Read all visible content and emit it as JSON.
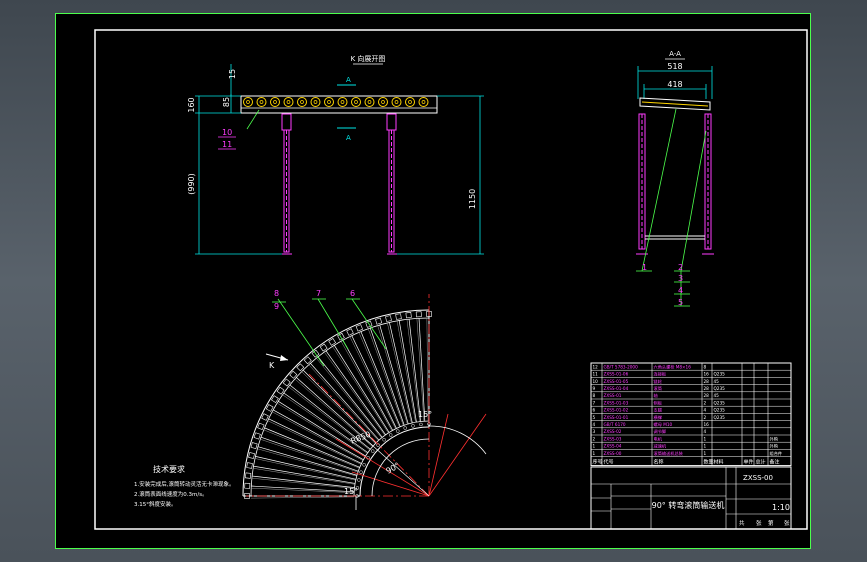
{
  "drawing": {
    "top_view_title": "K 向展开图",
    "section_mark": "A",
    "section_view_title": "A-A",
    "dimensions": {
      "d15": "15",
      "d160": "160",
      "d85": "85",
      "d990": "(990)",
      "d1150": "1150",
      "d518": "518",
      "d418": "418",
      "r850": "R850",
      "a90": "90°",
      "a15a": "15°",
      "a15b": "15°"
    },
    "view_k": "K",
    "callouts_front": [
      "10",
      "11"
    ],
    "callouts_side": [
      "1",
      "2",
      "3",
      "4",
      "5"
    ],
    "callouts_plan": [
      "8",
      "9",
      "7",
      "6"
    ],
    "tech_requirements": {
      "title": "技术要求",
      "items": [
        "1.安装完成后,滚筒转动灵活无卡滞现象。",
        "2.滚筒表面线速度为0.3m/s。",
        "3.15°斜度安装。"
      ]
    },
    "bom": {
      "header": [
        "序号",
        "代号",
        "名称",
        "数量",
        "材料",
        "单件",
        "总计",
        "备注"
      ],
      "rows": [
        [
          "12",
          "GB/T 5783-2000",
          "六角头螺栓 M8×16",
          "8",
          "",
          "",
          "",
          ""
        ],
        [
          "11",
          "ZXSS-01-06",
          "连接板",
          "16",
          "Q235",
          "",
          "",
          ""
        ],
        [
          "10",
          "ZXSS-01-05",
          "链轮",
          "28",
          "45",
          "",
          "",
          ""
        ],
        [
          "9",
          "ZXSS-01-04",
          "滚筒",
          "28",
          "Q235",
          "",
          "",
          ""
        ],
        [
          "8",
          "ZXSS-01",
          "轴",
          "28",
          "45",
          "",
          "",
          ""
        ],
        [
          "7",
          "ZXSS-01-03",
          "侧板",
          "2",
          "Q235",
          "",
          "",
          ""
        ],
        [
          "6",
          "ZXSS-01-02",
          "支腿",
          "4",
          "Q235",
          "",
          "",
          ""
        ],
        [
          "5",
          "ZXSS-01-01",
          "横撑",
          "2",
          "Q235",
          "",
          "",
          ""
        ],
        [
          "4",
          "GB/T 6170",
          "螺母 M10",
          "16",
          "",
          "",
          "",
          ""
        ],
        [
          "3",
          "ZXSS-02",
          "调节脚",
          "4",
          "",
          "",
          "",
          ""
        ],
        [
          "2",
          "ZXSS-03",
          "电机",
          "1",
          "",
          "",
          "",
          "外购"
        ],
        [
          "1",
          "ZXSS-04",
          "减速机",
          "1",
          "",
          "",
          "",
          "外购"
        ]
      ],
      "footer_row": [
        "1",
        "ZXSS-00",
        "滚筒输送机总装",
        "1",
        "",
        "",
        "",
        "组合件"
      ]
    },
    "title_block": {
      "drawing_number": "ZXSS-00",
      "title": "90° 转弯滚筒输送机",
      "scale": "1:10",
      "sheet_left": "共",
      "sheet_right": "张",
      "sheet_of": "第",
      "sheet_of_right": "张"
    },
    "colors": {
      "background": "#000000",
      "border": "#4cff4c",
      "frame": "#ffffff",
      "part": "#ffffff",
      "roller": "#ffd400",
      "leg": "#ff3cff",
      "dim": "#00e6e6",
      "leader": "#4cff4c",
      "center": "#ff3030"
    }
  }
}
